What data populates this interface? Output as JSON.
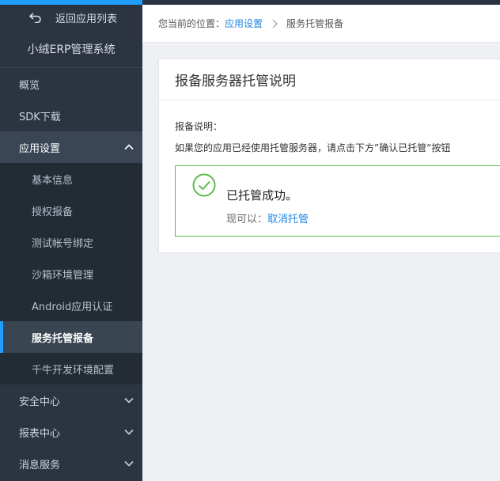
{
  "sidebar": {
    "back_label": "返回应用列表",
    "app_name": "小绒ERP管理系统",
    "items": [
      {
        "label": "概览"
      },
      {
        "label": "SDK下载"
      },
      {
        "label": "应用设置"
      },
      {
        "label": "安全中心"
      },
      {
        "label": "报表中心"
      },
      {
        "label": "消息服务"
      }
    ],
    "sub_items": [
      {
        "label": "基本信息"
      },
      {
        "label": "授权报备"
      },
      {
        "label": "测试帐号绑定"
      },
      {
        "label": "沙箱环境管理"
      },
      {
        "label": "Android应用认证"
      },
      {
        "label": "服务托管报备"
      },
      {
        "label": "千牛开发环境配置"
      }
    ]
  },
  "breadcrumb": {
    "prefix": "您当前的位置：",
    "parent": "应用设置",
    "current": "服务托管报备"
  },
  "panel": {
    "title": "报备服务器托管说明",
    "label": "报备说明：",
    "description": "如果您的应用已经使用托管服务器，请点击下方”确认已托管“按钮",
    "success_title": "已托管成功。",
    "success_prefix": "现可以：",
    "cancel_link": "取消托管"
  },
  "colors": {
    "sidebar_bg": "#2b3440",
    "accent": "#1e9fff",
    "link": "#1e88e5",
    "success": "#5dbb4c"
  }
}
